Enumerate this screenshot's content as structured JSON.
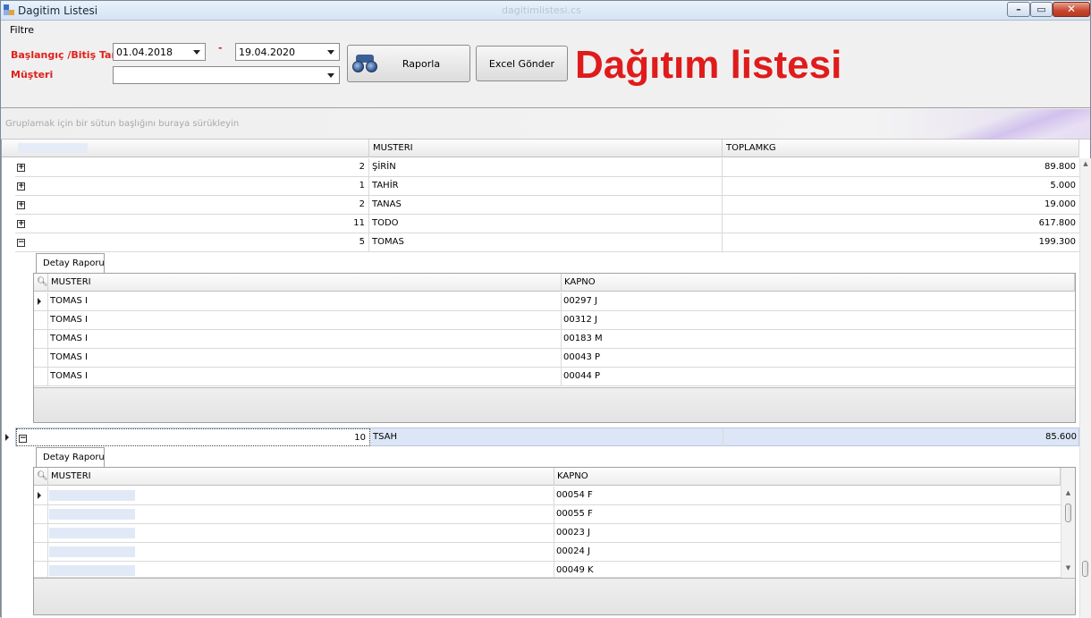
{
  "window": {
    "title": "Dagitim Listesi",
    "center_title": "dagitimlistesi.cs",
    "controls": {
      "minimize": "–",
      "maximize": "▭",
      "close": "✕"
    },
    "accent_color": "#e01b1b"
  },
  "menu": {
    "items": [
      {
        "label": "Filtre"
      }
    ]
  },
  "filters": {
    "date_label": "Başlangıç /Bitiş Tarihi",
    "customer_label": "Müşteri",
    "start_date": "01.04.2018",
    "separator": "-",
    "end_date": "19.04.2020",
    "customer_value": "",
    "report_button": "Raporla",
    "excel_button": "Excel Gönder",
    "heading": "Dağıtım listesi"
  },
  "grid": {
    "group_hint": "Gruplamak için bir sütun başlığını buraya sürükleyin",
    "columns": {
      "col2": "MUSTERI",
      "col3": "TOPLAMKG"
    },
    "rows": [
      {
        "expander": "+",
        "count": "2",
        "musteri": "ŞİRİN",
        "toplamkg": "89.800"
      },
      {
        "expander": "+",
        "count": "1",
        "musteri": "TAHİR",
        "toplamkg": "5.000"
      },
      {
        "expander": "+",
        "count": "2",
        "musteri": "TANAS",
        "toplamkg": "19.000"
      },
      {
        "expander": "+",
        "count": "11",
        "musteri": "TODO",
        "toplamkg": "617.800"
      },
      {
        "expander": "−",
        "count": "5",
        "musteri": "TOMAS",
        "toplamkg": "199.300"
      },
      {
        "expander": "−",
        "count": "10",
        "musteri": "TSAH",
        "toplamkg": "85.600"
      }
    ],
    "detail1": {
      "tab": "Detay Raporu",
      "columns": {
        "musteri": "MUSTERI",
        "kapno": "KAPNO"
      },
      "rows": [
        {
          "musteri": "TOMAS I",
          "kapno": "00297 J"
        },
        {
          "musteri": "TOMAS I",
          "kapno": "00312 J"
        },
        {
          "musteri": "TOMAS I",
          "kapno": "00183 M"
        },
        {
          "musteri": "TOMAS I",
          "kapno": "00043 P"
        },
        {
          "musteri": "TOMAS I",
          "kapno": "00044 P"
        }
      ]
    },
    "detail2": {
      "tab": "Detay Raporu",
      "columns": {
        "musteri": "MUSTERI",
        "kapno": "KAPNO"
      },
      "rows": [
        {
          "musteri": "",
          "kapno": "00054 F"
        },
        {
          "musteri": "",
          "kapno": "00055 F"
        },
        {
          "musteri": "",
          "kapno": "00023 J"
        },
        {
          "musteri": "",
          "kapno": "00024 J"
        },
        {
          "musteri": "",
          "kapno": "00049 K"
        }
      ]
    }
  }
}
